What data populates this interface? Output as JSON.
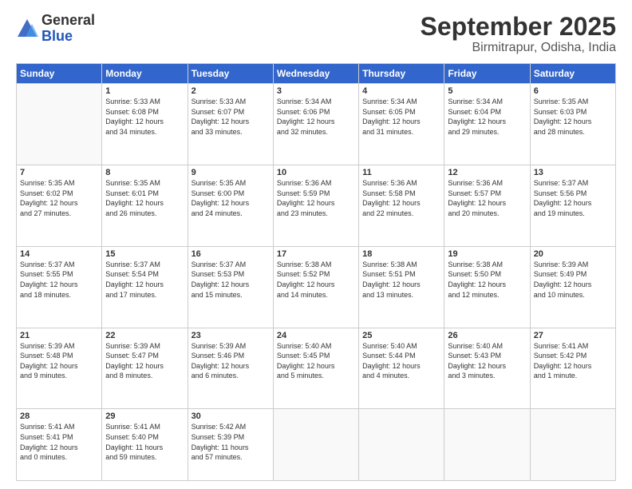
{
  "logo": {
    "general": "General",
    "blue": "Blue"
  },
  "header": {
    "month": "September 2025",
    "location": "Birmitrapur, Odisha, India"
  },
  "weekdays": [
    "Sunday",
    "Monday",
    "Tuesday",
    "Wednesday",
    "Thursday",
    "Friday",
    "Saturday"
  ],
  "weeks": [
    [
      {
        "day": "",
        "info": ""
      },
      {
        "day": "1",
        "info": "Sunrise: 5:33 AM\nSunset: 6:08 PM\nDaylight: 12 hours\nand 34 minutes."
      },
      {
        "day": "2",
        "info": "Sunrise: 5:33 AM\nSunset: 6:07 PM\nDaylight: 12 hours\nand 33 minutes."
      },
      {
        "day": "3",
        "info": "Sunrise: 5:34 AM\nSunset: 6:06 PM\nDaylight: 12 hours\nand 32 minutes."
      },
      {
        "day": "4",
        "info": "Sunrise: 5:34 AM\nSunset: 6:05 PM\nDaylight: 12 hours\nand 31 minutes."
      },
      {
        "day": "5",
        "info": "Sunrise: 5:34 AM\nSunset: 6:04 PM\nDaylight: 12 hours\nand 29 minutes."
      },
      {
        "day": "6",
        "info": "Sunrise: 5:35 AM\nSunset: 6:03 PM\nDaylight: 12 hours\nand 28 minutes."
      }
    ],
    [
      {
        "day": "7",
        "info": "Sunrise: 5:35 AM\nSunset: 6:02 PM\nDaylight: 12 hours\nand 27 minutes."
      },
      {
        "day": "8",
        "info": "Sunrise: 5:35 AM\nSunset: 6:01 PM\nDaylight: 12 hours\nand 26 minutes."
      },
      {
        "day": "9",
        "info": "Sunrise: 5:35 AM\nSunset: 6:00 PM\nDaylight: 12 hours\nand 24 minutes."
      },
      {
        "day": "10",
        "info": "Sunrise: 5:36 AM\nSunset: 5:59 PM\nDaylight: 12 hours\nand 23 minutes."
      },
      {
        "day": "11",
        "info": "Sunrise: 5:36 AM\nSunset: 5:58 PM\nDaylight: 12 hours\nand 22 minutes."
      },
      {
        "day": "12",
        "info": "Sunrise: 5:36 AM\nSunset: 5:57 PM\nDaylight: 12 hours\nand 20 minutes."
      },
      {
        "day": "13",
        "info": "Sunrise: 5:37 AM\nSunset: 5:56 PM\nDaylight: 12 hours\nand 19 minutes."
      }
    ],
    [
      {
        "day": "14",
        "info": "Sunrise: 5:37 AM\nSunset: 5:55 PM\nDaylight: 12 hours\nand 18 minutes."
      },
      {
        "day": "15",
        "info": "Sunrise: 5:37 AM\nSunset: 5:54 PM\nDaylight: 12 hours\nand 17 minutes."
      },
      {
        "day": "16",
        "info": "Sunrise: 5:37 AM\nSunset: 5:53 PM\nDaylight: 12 hours\nand 15 minutes."
      },
      {
        "day": "17",
        "info": "Sunrise: 5:38 AM\nSunset: 5:52 PM\nDaylight: 12 hours\nand 14 minutes."
      },
      {
        "day": "18",
        "info": "Sunrise: 5:38 AM\nSunset: 5:51 PM\nDaylight: 12 hours\nand 13 minutes."
      },
      {
        "day": "19",
        "info": "Sunrise: 5:38 AM\nSunset: 5:50 PM\nDaylight: 12 hours\nand 12 minutes."
      },
      {
        "day": "20",
        "info": "Sunrise: 5:39 AM\nSunset: 5:49 PM\nDaylight: 12 hours\nand 10 minutes."
      }
    ],
    [
      {
        "day": "21",
        "info": "Sunrise: 5:39 AM\nSunset: 5:48 PM\nDaylight: 12 hours\nand 9 minutes."
      },
      {
        "day": "22",
        "info": "Sunrise: 5:39 AM\nSunset: 5:47 PM\nDaylight: 12 hours\nand 8 minutes."
      },
      {
        "day": "23",
        "info": "Sunrise: 5:39 AM\nSunset: 5:46 PM\nDaylight: 12 hours\nand 6 minutes."
      },
      {
        "day": "24",
        "info": "Sunrise: 5:40 AM\nSunset: 5:45 PM\nDaylight: 12 hours\nand 5 minutes."
      },
      {
        "day": "25",
        "info": "Sunrise: 5:40 AM\nSunset: 5:44 PM\nDaylight: 12 hours\nand 4 minutes."
      },
      {
        "day": "26",
        "info": "Sunrise: 5:40 AM\nSunset: 5:43 PM\nDaylight: 12 hours\nand 3 minutes."
      },
      {
        "day": "27",
        "info": "Sunrise: 5:41 AM\nSunset: 5:42 PM\nDaylight: 12 hours\nand 1 minute."
      }
    ],
    [
      {
        "day": "28",
        "info": "Sunrise: 5:41 AM\nSunset: 5:41 PM\nDaylight: 12 hours\nand 0 minutes."
      },
      {
        "day": "29",
        "info": "Sunrise: 5:41 AM\nSunset: 5:40 PM\nDaylight: 11 hours\nand 59 minutes."
      },
      {
        "day": "30",
        "info": "Sunrise: 5:42 AM\nSunset: 5:39 PM\nDaylight: 11 hours\nand 57 minutes."
      },
      {
        "day": "",
        "info": ""
      },
      {
        "day": "",
        "info": ""
      },
      {
        "day": "",
        "info": ""
      },
      {
        "day": "",
        "info": ""
      }
    ]
  ]
}
